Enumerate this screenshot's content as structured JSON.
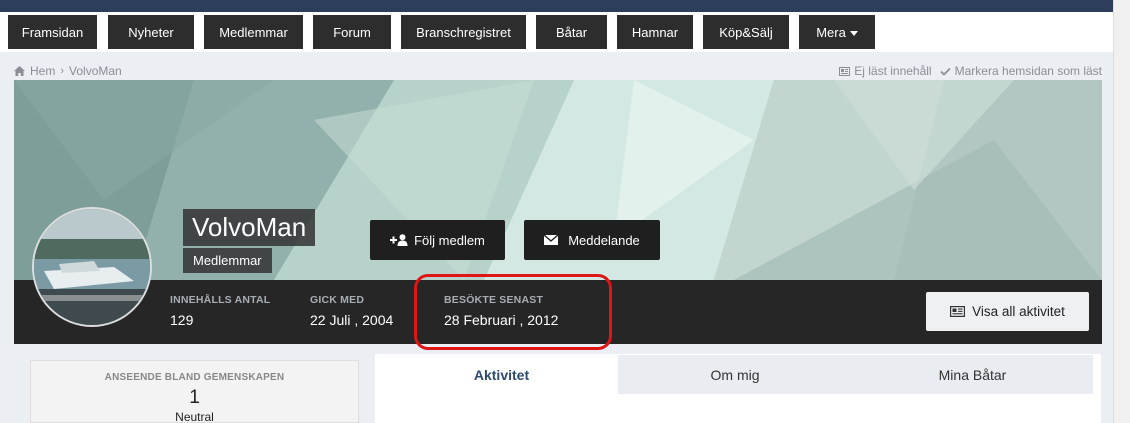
{
  "nav": {
    "items": [
      "Framsidan",
      "Nyheter",
      "Medlemmar",
      "Forum",
      "Branschregistret",
      "Båtar",
      "Hamnar",
      "Köp&Sälj",
      "Mera"
    ]
  },
  "breadcrumb": {
    "home": "Hem",
    "current": "VolvoMan",
    "unread": "Ej läst innehåll",
    "mark_read": "Markera hemsidan som läst"
  },
  "profile": {
    "name": "VolvoMan",
    "group": "Medlemmar",
    "follow_label": "Följ medlem",
    "message_label": "Meddelande",
    "view_activity_label": "Visa all aktivitet"
  },
  "stats": {
    "content_count_label": "INNEHÅLLS ANTAL",
    "content_count": "129",
    "joined_label": "GICK MED",
    "joined": "22 Juli , 2004",
    "last_visited_label": "BESÖKTE SENAST",
    "last_visited": "28 Februari , 2012"
  },
  "reputation": {
    "label": "ANSEENDE BLAND GEMENSKAPEN",
    "value": "1",
    "level": "Neutral"
  },
  "tabs": [
    "Aktivitet",
    "Om mig",
    "Mina Båtar"
  ],
  "colors": {
    "nav_bg": "#2d2d2d",
    "info_bar_bg": "#262626",
    "highlight": "#e01515",
    "active_tab_text": "#2c4a70"
  }
}
